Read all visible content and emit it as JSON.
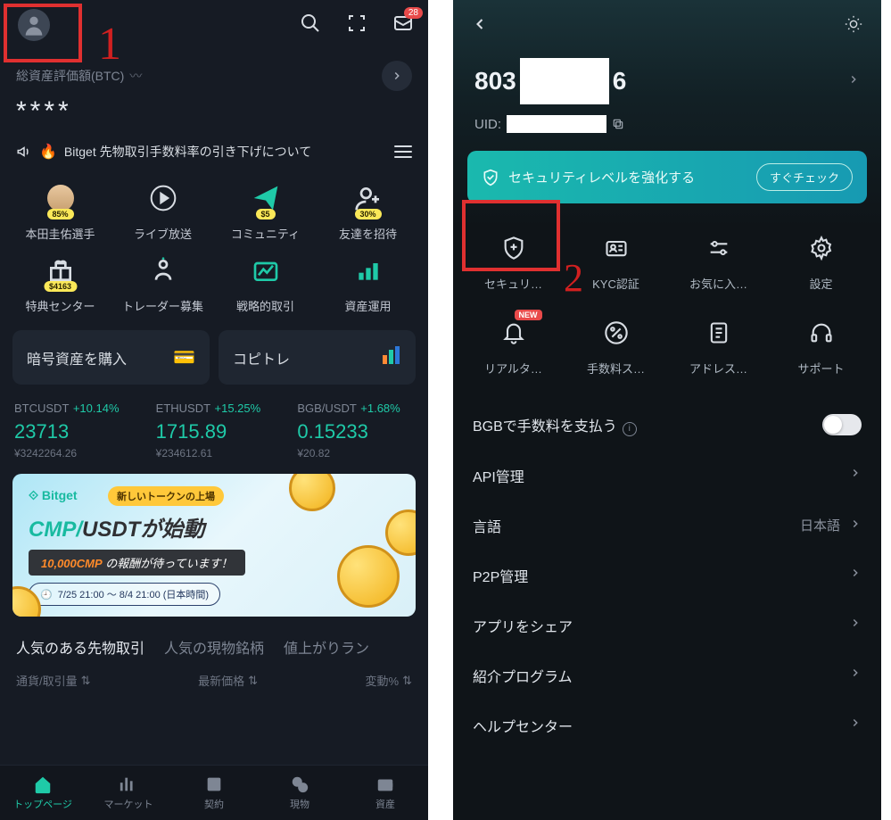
{
  "left": {
    "badge_count": "28",
    "balance_label": "総資産評価額(BTC)",
    "balance_value": "****",
    "news": "Bitget 先物取引手数料率の引き下げについて",
    "grid": [
      {
        "label": "本田圭佑選手",
        "pill": "85%"
      },
      {
        "label": "ライブ放送",
        "pill": ""
      },
      {
        "label": "コミュニティ",
        "pill": "$5"
      },
      {
        "label": "友達を招待",
        "pill": "30%",
        "invite": true
      },
      {
        "label": "特典センター",
        "pill": "$4163"
      },
      {
        "label": "トレーダー募集",
        "pill": ""
      },
      {
        "label": "戦略的取引",
        "pill": ""
      },
      {
        "label": "資産運用",
        "pill": ""
      }
    ],
    "card_buy": "暗号資産を購入",
    "card_copy": "コピトレ",
    "tickers": [
      {
        "pair": "BTCUSDT",
        "change": "+10.14%",
        "price": "23713",
        "fiat": "¥3242264.26"
      },
      {
        "pair": "ETHUSDT",
        "change": "+15.25%",
        "price": "1715.89",
        "fiat": "¥234612.61"
      },
      {
        "pair": "BGB/USDT",
        "change": "+1.68%",
        "price": "0.15233",
        "fiat": "¥20.82"
      }
    ],
    "banner": {
      "logo": "Bitget",
      "chip": "新しいトークンの上場",
      "title_pre": "CMP/",
      "title_mid": "USDT",
      "title_post": "が始動",
      "reward_amount": "10,000CMP",
      "reward_text": " の報酬が待っています！",
      "time": "7/25 21:00 ～ 8/4 21:00 (日本時間)"
    },
    "tabs": [
      {
        "label": "人気のある先物取引",
        "active": true
      },
      {
        "label": "人気の現物銘柄",
        "active": false
      },
      {
        "label": "値上がりラン",
        "active": false
      }
    ],
    "sort": {
      "pair": "通貨/取引量",
      "price": "最新価格",
      "change": "変動%"
    },
    "nav": [
      {
        "label": "トップページ",
        "active": true
      },
      {
        "label": "マーケット",
        "active": false
      },
      {
        "label": "契約",
        "active": false
      },
      {
        "label": "現物",
        "active": false
      },
      {
        "label": "資産",
        "active": false
      }
    ],
    "annotation": "1"
  },
  "right": {
    "phone_prefix": "803",
    "phone_suffix": "6",
    "uid_label": "UID:",
    "security_text": "セキュリティレベルを強化する",
    "security_btn": "すぐチェック",
    "grid": [
      {
        "label": "セキュリ…"
      },
      {
        "label": "KYC認証"
      },
      {
        "label": "お気に入…"
      },
      {
        "label": "設定"
      },
      {
        "label": "リアルタ…",
        "new": true
      },
      {
        "label": "手数料ス…"
      },
      {
        "label": "アドレス…"
      },
      {
        "label": "サポート"
      }
    ],
    "settings": {
      "bgb": "BGBで手数料を支払う",
      "api": "API管理",
      "lang": "言語",
      "lang_val": "日本語",
      "p2p": "P2P管理",
      "share": "アプリをシェア",
      "referral": "紹介プログラム",
      "help": "ヘルプセンター"
    },
    "annotation": "2"
  }
}
